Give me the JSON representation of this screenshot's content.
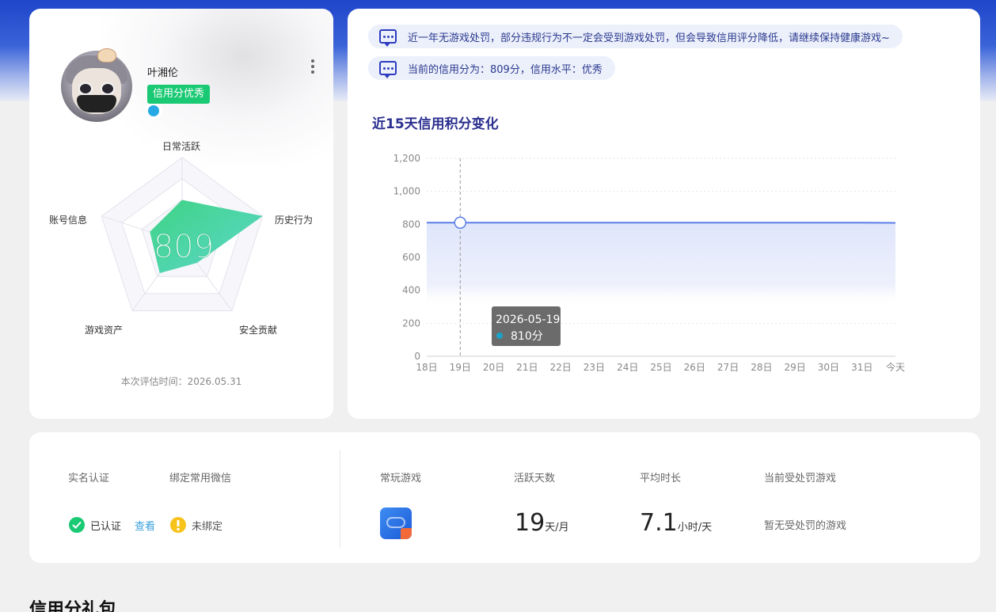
{
  "profile": {
    "user_name": "叶湘伦",
    "credit_badge": "信用分优秀",
    "score": "809",
    "radar_labels": {
      "top": "日常活跃",
      "right": "历史行为",
      "bottom_right": "安全贡献",
      "bottom_left": "游戏资产",
      "left": "账号信息"
    },
    "radar_values": {
      "日常活跃": 0.5,
      "历史行为": 1.0,
      "安全贡献": 0.3,
      "游戏资产": 0.45,
      "账号信息": 0.4
    },
    "eval_time": "本次评估时间：2026.05.31"
  },
  "notices": {
    "notice_1": "近一年无游戏处罚，部分违规行为不一定会受到游戏处罚，但会导致信用评分降低，请继续保持健康游戏~",
    "notice_2": "当前的信用分为：809分，信用水平：优秀"
  },
  "chart_data": {
    "type": "area",
    "title": "近15天信用积分变化",
    "categories": [
      "18日",
      "19日",
      "20日",
      "21日",
      "22日",
      "23日",
      "24日",
      "25日",
      "26日",
      "27日",
      "28日",
      "29日",
      "30日",
      "31日",
      "今天"
    ],
    "series": [
      {
        "values": [
          810,
          810,
          810,
          810,
          810,
          810,
          810,
          810,
          810,
          810,
          810,
          810,
          810,
          810,
          809
        ]
      }
    ],
    "y_ticks": [
      "0",
      "200",
      "400",
      "600",
      "800",
      "1,000",
      "1,200"
    ],
    "ylim": [
      0,
      1200
    ],
    "grid": true,
    "tooltip": {
      "date": "2026-05-19",
      "value": "810分"
    },
    "colors": {
      "line": "#5b7ee8",
      "area": "#e6ebfb",
      "tooltip_bg": "#6b6b6b"
    }
  },
  "stats": {
    "realname_label": "实名认证",
    "wechat_label": "绑定常用微信",
    "realname_value": "已认证",
    "realname_link": "查看",
    "wechat_value": "未绑定",
    "frequent_games_label": "常玩游戏",
    "active_days_label": "活跃天数",
    "active_days_value": "19",
    "active_days_unit": "天/月",
    "avg_time_label": "平均时长",
    "avg_time_value": "7.1",
    "avg_time_unit": "小时/天",
    "punished_label": "当前受处罚游戏",
    "punished_value": "暂无受处罚的游戏"
  },
  "gift_section_title": "信用分礼包",
  "colors": {
    "brand_blue": "#1f45c9",
    "success_green": "#1ac973",
    "warning_yellow": "#f7c21a",
    "link_blue": "#3aa0dc"
  }
}
